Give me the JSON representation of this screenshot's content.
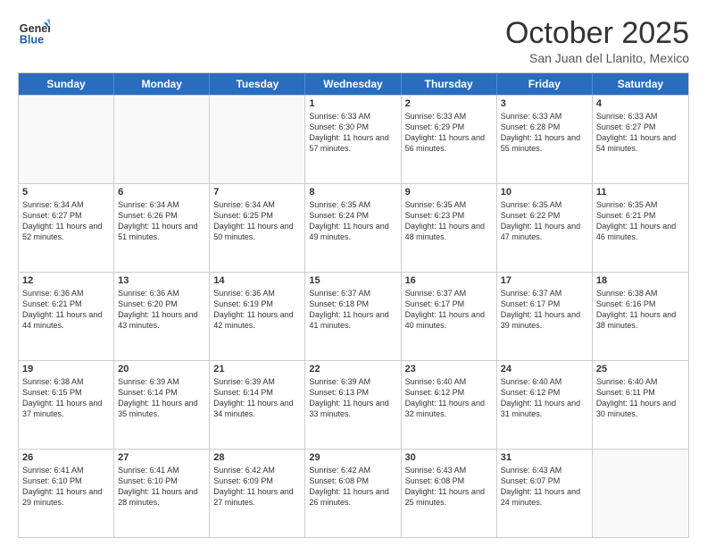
{
  "header": {
    "logo_line1": "General",
    "logo_line2": "Blue",
    "month": "October 2025",
    "location": "San Juan del Llanito, Mexico"
  },
  "weekdays": [
    "Sunday",
    "Monday",
    "Tuesday",
    "Wednesday",
    "Thursday",
    "Friday",
    "Saturday"
  ],
  "rows": [
    [
      {
        "day": "",
        "info": ""
      },
      {
        "day": "",
        "info": ""
      },
      {
        "day": "",
        "info": ""
      },
      {
        "day": "1",
        "info": "Sunrise: 6:33 AM\nSunset: 6:30 PM\nDaylight: 11 hours\nand 57 minutes."
      },
      {
        "day": "2",
        "info": "Sunrise: 6:33 AM\nSunset: 6:29 PM\nDaylight: 11 hours\nand 56 minutes."
      },
      {
        "day": "3",
        "info": "Sunrise: 6:33 AM\nSunset: 6:28 PM\nDaylight: 11 hours\nand 55 minutes."
      },
      {
        "day": "4",
        "info": "Sunrise: 6:33 AM\nSunset: 6:27 PM\nDaylight: 11 hours\nand 54 minutes."
      }
    ],
    [
      {
        "day": "5",
        "info": "Sunrise: 6:34 AM\nSunset: 6:27 PM\nDaylight: 11 hours\nand 52 minutes."
      },
      {
        "day": "6",
        "info": "Sunrise: 6:34 AM\nSunset: 6:26 PM\nDaylight: 11 hours\nand 51 minutes."
      },
      {
        "day": "7",
        "info": "Sunrise: 6:34 AM\nSunset: 6:25 PM\nDaylight: 11 hours\nand 50 minutes."
      },
      {
        "day": "8",
        "info": "Sunrise: 6:35 AM\nSunset: 6:24 PM\nDaylight: 11 hours\nand 49 minutes."
      },
      {
        "day": "9",
        "info": "Sunrise: 6:35 AM\nSunset: 6:23 PM\nDaylight: 11 hours\nand 48 minutes."
      },
      {
        "day": "10",
        "info": "Sunrise: 6:35 AM\nSunset: 6:22 PM\nDaylight: 11 hours\nand 47 minutes."
      },
      {
        "day": "11",
        "info": "Sunrise: 6:35 AM\nSunset: 6:21 PM\nDaylight: 11 hours\nand 46 minutes."
      }
    ],
    [
      {
        "day": "12",
        "info": "Sunrise: 6:36 AM\nSunset: 6:21 PM\nDaylight: 11 hours\nand 44 minutes."
      },
      {
        "day": "13",
        "info": "Sunrise: 6:36 AM\nSunset: 6:20 PM\nDaylight: 11 hours\nand 43 minutes."
      },
      {
        "day": "14",
        "info": "Sunrise: 6:36 AM\nSunset: 6:19 PM\nDaylight: 11 hours\nand 42 minutes."
      },
      {
        "day": "15",
        "info": "Sunrise: 6:37 AM\nSunset: 6:18 PM\nDaylight: 11 hours\nand 41 minutes."
      },
      {
        "day": "16",
        "info": "Sunrise: 6:37 AM\nSunset: 6:17 PM\nDaylight: 11 hours\nand 40 minutes."
      },
      {
        "day": "17",
        "info": "Sunrise: 6:37 AM\nSunset: 6:17 PM\nDaylight: 11 hours\nand 39 minutes."
      },
      {
        "day": "18",
        "info": "Sunrise: 6:38 AM\nSunset: 6:16 PM\nDaylight: 11 hours\nand 38 minutes."
      }
    ],
    [
      {
        "day": "19",
        "info": "Sunrise: 6:38 AM\nSunset: 6:15 PM\nDaylight: 11 hours\nand 37 minutes."
      },
      {
        "day": "20",
        "info": "Sunrise: 6:39 AM\nSunset: 6:14 PM\nDaylight: 11 hours\nand 35 minutes."
      },
      {
        "day": "21",
        "info": "Sunrise: 6:39 AM\nSunset: 6:14 PM\nDaylight: 11 hours\nand 34 minutes."
      },
      {
        "day": "22",
        "info": "Sunrise: 6:39 AM\nSunset: 6:13 PM\nDaylight: 11 hours\nand 33 minutes."
      },
      {
        "day": "23",
        "info": "Sunrise: 6:40 AM\nSunset: 6:12 PM\nDaylight: 11 hours\nand 32 minutes."
      },
      {
        "day": "24",
        "info": "Sunrise: 6:40 AM\nSunset: 6:12 PM\nDaylight: 11 hours\nand 31 minutes."
      },
      {
        "day": "25",
        "info": "Sunrise: 6:40 AM\nSunset: 6:11 PM\nDaylight: 11 hours\nand 30 minutes."
      }
    ],
    [
      {
        "day": "26",
        "info": "Sunrise: 6:41 AM\nSunset: 6:10 PM\nDaylight: 11 hours\nand 29 minutes."
      },
      {
        "day": "27",
        "info": "Sunrise: 6:41 AM\nSunset: 6:10 PM\nDaylight: 11 hours\nand 28 minutes."
      },
      {
        "day": "28",
        "info": "Sunrise: 6:42 AM\nSunset: 6:09 PM\nDaylight: 11 hours\nand 27 minutes."
      },
      {
        "day": "29",
        "info": "Sunrise: 6:42 AM\nSunset: 6:08 PM\nDaylight: 11 hours\nand 26 minutes."
      },
      {
        "day": "30",
        "info": "Sunrise: 6:43 AM\nSunset: 6:08 PM\nDaylight: 11 hours\nand 25 minutes."
      },
      {
        "day": "31",
        "info": "Sunrise: 6:43 AM\nSunset: 6:07 PM\nDaylight: 11 hours\nand 24 minutes."
      },
      {
        "day": "",
        "info": ""
      }
    ]
  ]
}
